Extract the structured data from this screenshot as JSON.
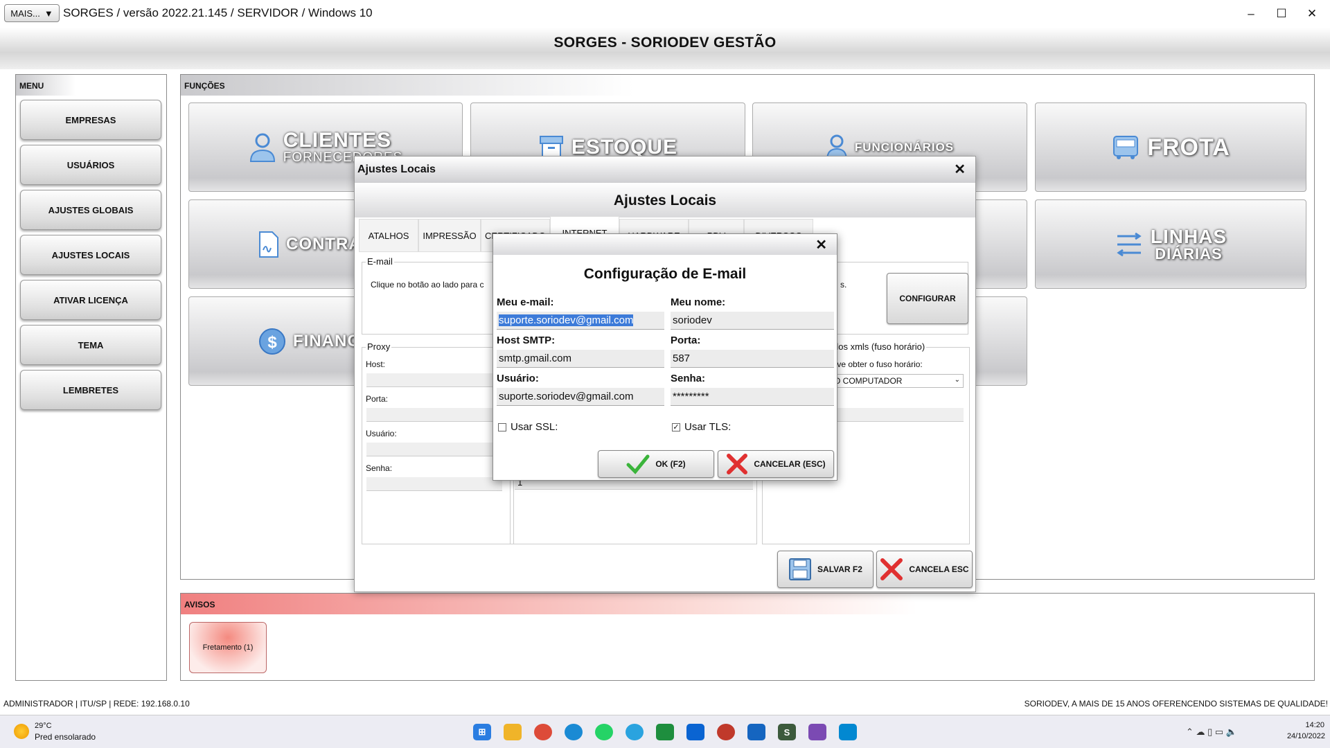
{
  "window": {
    "mais_label": "MAIS...",
    "title": "SORGES / versão 2022.21.145 / SERVIDOR / Windows 10",
    "main_title": "SORGES - SORIODEV GESTÃO"
  },
  "menu": {
    "header": "MENU",
    "items": [
      "EMPRESAS",
      "USUÁRIOS",
      "AJUSTES GLOBAIS",
      "AJUSTES LOCAIS",
      "ATIVAR LICENÇA",
      "TEMA",
      "LEMBRETES"
    ]
  },
  "funcoes": {
    "header": "FUNÇÕES",
    "clientes": "CLIENTES",
    "clientes_sub": "FORNECEDORES",
    "estoque": "ESTOQUE",
    "funcionarios": "FUNCIONÁRIOS",
    "frota": "FROTA",
    "contratos": "CONTRA",
    "linhas": "LINHAS",
    "linhas_sub": "DIÁRIAS",
    "financeiro": "FINANC"
  },
  "avisos": {
    "header": "AVISOS",
    "item": "Fretamento (1)"
  },
  "status": {
    "left": "ADMINISTRADOR |  ITU/SP |   REDE: 192.168.0.10",
    "right": "SORIODEV, A MAIS DE 15 ANOS OFERENCENDO SISTEMAS DE QUALIDADE!"
  },
  "taskbar": {
    "weather_temp": "29°C",
    "weather_desc": "Pred ensolarado",
    "time": "14:20",
    "date": "24/10/2022"
  },
  "ajustes": {
    "window_title": "Ajustes Locais",
    "header": "Ajustes Locais",
    "tabs": [
      "ATALHOS",
      "IMPRESSÃO",
      "CERTIFICADO",
      "INTERNET",
      "HARDWARE",
      "PDV",
      "DIVERSOS"
    ],
    "email_group": "E-mail",
    "email_text": "Clique no botão ao lado para c",
    "email_text_end": "s.",
    "configurar": "CONFIGURAR",
    "proxy_group": "Proxy",
    "proxy_host": "Host:",
    "proxy_porta": "Porta:",
    "proxy_usuario": "Usuário:",
    "proxy_senha": "Senha:",
    "mid_value": "1",
    "xml_group": "dos xmls (fuso horário)",
    "xml_label": "leve obter o fuso horário:",
    "xml_select": "O COMPUTADOR",
    "xml_label2": "o:",
    "salvar": "SALVAR F2",
    "cancela": "CANCELA ESC"
  },
  "email_config": {
    "title": "Configuração de E-mail",
    "meu_email_label": "Meu e-mail:",
    "meu_email_value": "suporte.soriodev@gmail.com",
    "meu_nome_label": "Meu nome:",
    "meu_nome_value": "soriodev",
    "host_label": "Host SMTP:",
    "host_value": "smtp.gmail.com",
    "porta_label": "Porta:",
    "porta_value": "587",
    "usuario_label": "Usuário:",
    "usuario_value": "suporte.soriodev@gmail.com",
    "senha_label": "Senha:",
    "senha_value": "*********",
    "ssl_label": "Usar SSL:",
    "ssl_checked": false,
    "tls_label": "Usar TLS:",
    "tls_checked": true,
    "ok_label": "OK (F2)",
    "cancel_label": "CANCELAR (ESC)"
  }
}
